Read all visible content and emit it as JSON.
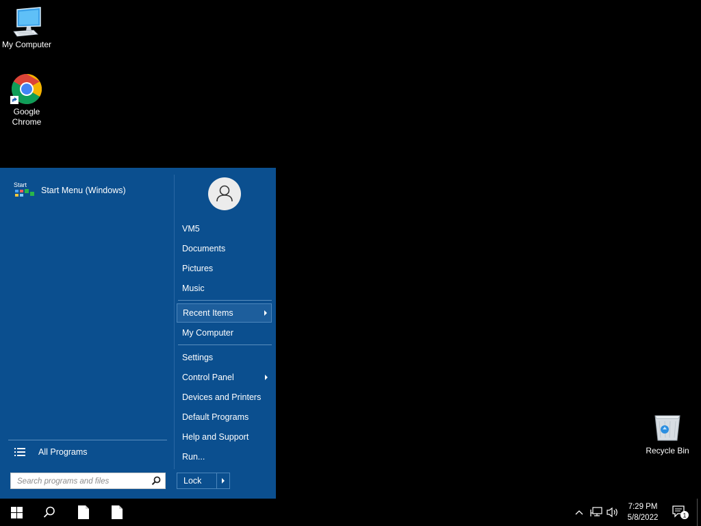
{
  "desktop": {
    "icons": [
      {
        "label": "My Computer",
        "icon": "computer-icon"
      },
      {
        "label_line1": "Google",
        "label_line2": "Chrome",
        "icon": "chrome-icon"
      },
      {
        "label": "Recycle Bin",
        "icon": "recycle-bin-icon"
      }
    ]
  },
  "start_menu": {
    "pinned": [
      {
        "label": "Start Menu (Windows)",
        "icon_text": "Start"
      }
    ],
    "all_programs_label": "All Programs",
    "search": {
      "placeholder": "Search programs and files",
      "value": ""
    },
    "right_items": [
      {
        "label": "VM5"
      },
      {
        "label": "Documents"
      },
      {
        "label": "Pictures"
      },
      {
        "label": "Music"
      },
      {
        "label": "Recent Items",
        "has_submenu": true,
        "highlighted": true
      },
      {
        "label": "My Computer"
      },
      {
        "label": "Settings"
      },
      {
        "label": "Control Panel",
        "has_submenu": true
      },
      {
        "label": "Devices and Printers"
      },
      {
        "label": "Default Programs"
      },
      {
        "label": "Help and Support"
      },
      {
        "label": "Run..."
      }
    ],
    "lock_label": "Lock",
    "colors": {
      "background": "#0b4f8f",
      "highlight": "#1d5e9c"
    }
  },
  "taskbar": {
    "buttons": [
      "windows-start-icon",
      "search-icon",
      "document-icon",
      "document-icon"
    ],
    "tray": {
      "time": "7:29 PM",
      "date": "5/8/2022",
      "notification_count": "1",
      "icons": [
        "chevron-up-icon",
        "network-icon",
        "volume-icon",
        "action-center-icon"
      ]
    }
  }
}
